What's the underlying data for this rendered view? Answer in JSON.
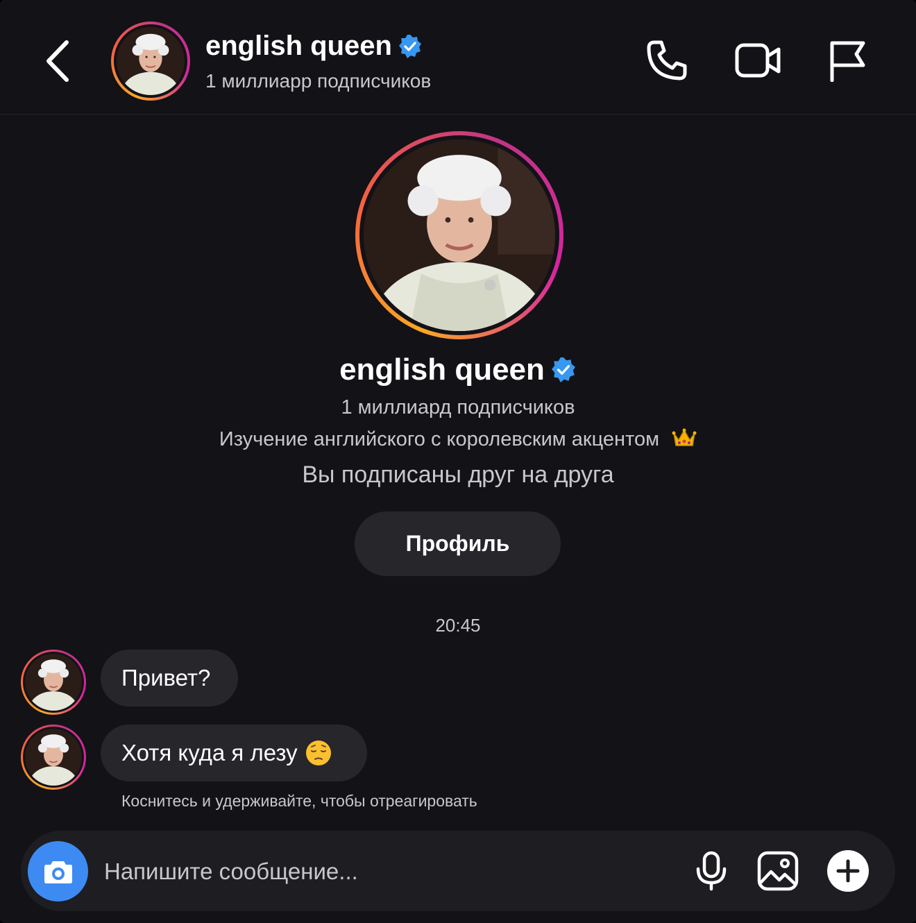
{
  "header": {
    "name": "english queen",
    "subtitle": "1 миллиарр подписчиков",
    "icons": [
      "back-arrow-icon",
      "phone-icon",
      "video-camera-icon",
      "flag-icon"
    ]
  },
  "profile": {
    "name": "english queen",
    "followers": "1 миллиард подписчиков",
    "bio": "Изучение английского с королевским акцентом",
    "bio_emoji": "crown-icon",
    "mutual": "Вы подписаны друг на друга",
    "button_label": "Профиль"
  },
  "conversation": {
    "timestamp": "20:45",
    "messages": [
      {
        "text": "Привет?"
      },
      {
        "text": "Хотя куда я лезу",
        "emoji": "pensive-face-icon"
      }
    ],
    "hint": "Коснитесь и удерживайте, чтобы отреагировать"
  },
  "composer": {
    "placeholder": "Напишите сообщение...",
    "value": "",
    "icons": [
      "camera-icon",
      "microphone-icon",
      "image-icon",
      "plus-icon"
    ]
  },
  "colors": {
    "background": "#121217",
    "bubble": "#26262b",
    "accent_blue": "#3d8bf2",
    "verified": "#3897f0",
    "secondary_text": "#c8c8cc"
  }
}
